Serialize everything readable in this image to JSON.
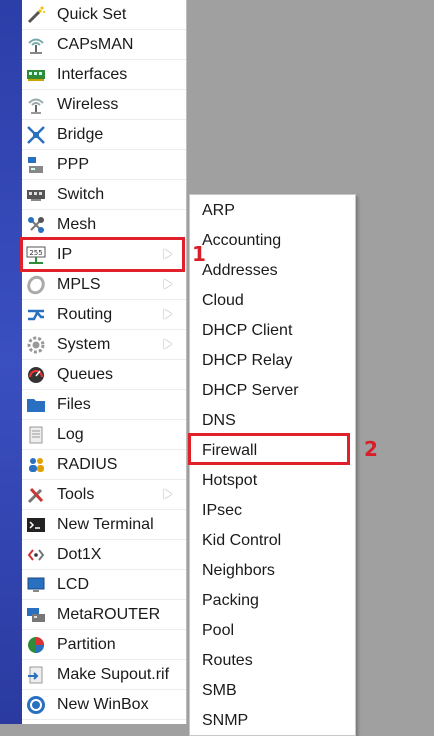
{
  "menu": {
    "items": [
      {
        "label": "Quick Set",
        "icon": "magic-wand-icon",
        "submenu": false
      },
      {
        "label": "CAPsMAN",
        "icon": "antenna-icon",
        "submenu": false
      },
      {
        "label": "Interfaces",
        "icon": "network-card-icon",
        "submenu": false
      },
      {
        "label": "Wireless",
        "icon": "wireless-icon",
        "submenu": false
      },
      {
        "label": "Bridge",
        "icon": "bridge-icon",
        "submenu": false
      },
      {
        "label": "PPP",
        "icon": "ppp-icon",
        "submenu": false
      },
      {
        "label": "Switch",
        "icon": "switch-icon",
        "submenu": false
      },
      {
        "label": "Mesh",
        "icon": "mesh-icon",
        "submenu": false
      },
      {
        "label": "IP",
        "icon": "ip-icon",
        "submenu": true
      },
      {
        "label": "MPLS",
        "icon": "mpls-icon",
        "submenu": true
      },
      {
        "label": "Routing",
        "icon": "routing-icon",
        "submenu": true
      },
      {
        "label": "System",
        "icon": "gear-icon",
        "submenu": true
      },
      {
        "label": "Queues",
        "icon": "gauge-icon",
        "submenu": false
      },
      {
        "label": "Files",
        "icon": "folder-icon",
        "submenu": false
      },
      {
        "label": "Log",
        "icon": "log-icon",
        "submenu": false
      },
      {
        "label": "RADIUS",
        "icon": "users-icon",
        "submenu": false
      },
      {
        "label": "Tools",
        "icon": "tools-icon",
        "submenu": true
      },
      {
        "label": "New Terminal",
        "icon": "terminal-icon",
        "submenu": false
      },
      {
        "label": "Dot1X",
        "icon": "dot1x-icon",
        "submenu": false
      },
      {
        "label": "LCD",
        "icon": "monitor-icon",
        "submenu": false
      },
      {
        "label": "MetaROUTER",
        "icon": "metarouter-icon",
        "submenu": false
      },
      {
        "label": "Partition",
        "icon": "pie-chart-icon",
        "submenu": false
      },
      {
        "label": "Make Supout.rif",
        "icon": "document-arrow-icon",
        "submenu": false
      },
      {
        "label": "New WinBox",
        "icon": "winbox-icon",
        "submenu": false
      }
    ]
  },
  "ip_submenu": {
    "items": [
      "ARP",
      "Accounting",
      "Addresses",
      "Cloud",
      "DHCP Client",
      "DHCP Relay",
      "DHCP Server",
      "DNS",
      "Firewall",
      "Hotspot",
      "IPsec",
      "Kid Control",
      "Neighbors",
      "Packing",
      "Pool",
      "Routes",
      "SMB",
      "SNMP"
    ]
  },
  "annotations": {
    "step1": "1",
    "step2": "2",
    "color": "#e0202a"
  }
}
